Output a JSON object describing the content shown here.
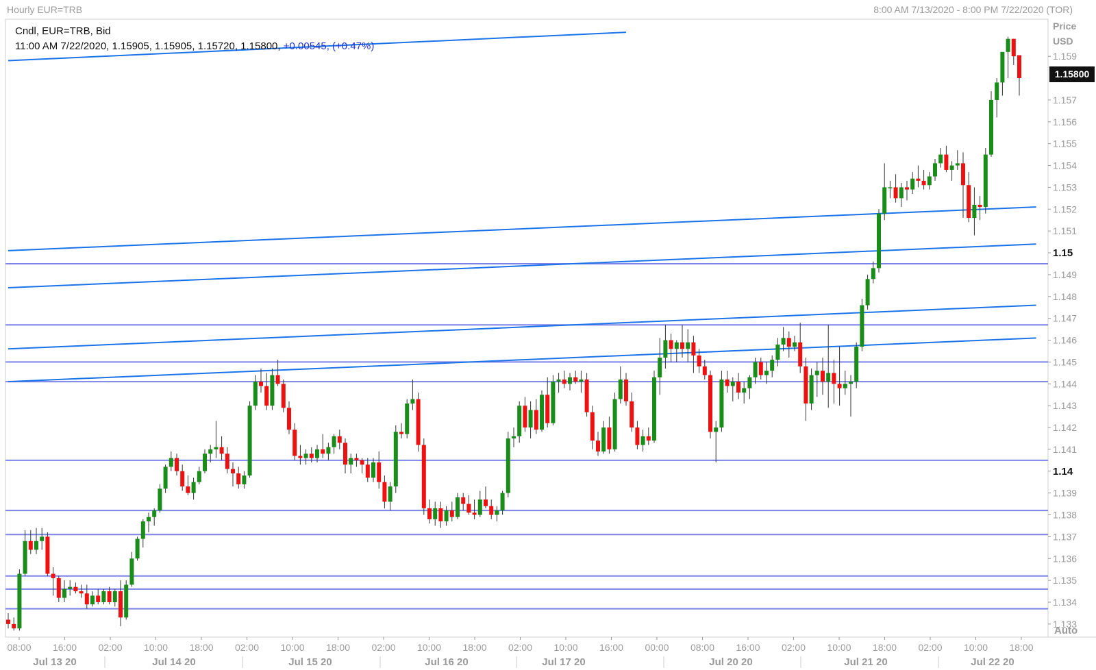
{
  "header": {
    "title": "Hourly EUR=TRB",
    "range": "8:00 AM 7/13/2020 - 8:00 PM 7/22/2020 (TOR)"
  },
  "info": {
    "line1": "Cndl, EUR=TRB, Bid",
    "line2_prefix": "11:00 AM 7/22/2020, 1.15905, 1.15905, 1.15720, 1.15800, ",
    "line2_change": "+0.00545, (+0.47%)"
  },
  "price_axis": {
    "label1": "Price",
    "label2": "USD",
    "current": "1.15800",
    "auto_label": "Auto"
  },
  "colors": {
    "up": "#1a8c1a",
    "down": "#ee1111",
    "trend": "#1a73e8",
    "level": "#7b83e8",
    "axis_text": "#9a9a9a"
  },
  "chart_data": {
    "type": "candlestick",
    "ylim": [
      1.1324,
      1.1607
    ],
    "y_ticks": [
      "1.133",
      "1.134",
      "1.135",
      "1.136",
      "1.137",
      "1.138",
      "1.139",
      "1.14",
      "1.141",
      "1.142",
      "1.143",
      "1.144",
      "1.145",
      "1.146",
      "1.147",
      "1.148",
      "1.149",
      "1.15",
      "1.151",
      "1.152",
      "1.153",
      "1.154",
      "1.155",
      "1.156",
      "1.157",
      "1.159"
    ],
    "bold_ticks": [
      "1.14",
      "1.15"
    ],
    "x_ticks": [
      "08:00",
      "16:00",
      "02:00",
      "10:00",
      "18:00",
      "02:00",
      "10:00",
      "18:00",
      "02:00",
      "10:00",
      "18:00",
      "02:00",
      "10:00",
      "16:00",
      "00:00",
      "08:00",
      "16:00",
      "02:00",
      "10:00",
      "18:00",
      "02:00",
      "10:00",
      "18:00"
    ],
    "date_labels": [
      "Jul 13 20",
      "Jul 14 20",
      "Jul 15 20",
      "Jul 16 20",
      "Jul 17 20",
      "Jul 20 20",
      "Jul 21 20",
      "Jul 22 20"
    ],
    "horizontal_levels": [
      1.1495,
      1.1467,
      1.145,
      1.1441,
      1.1405,
      1.1382,
      1.1371,
      1.1352,
      1.1346,
      1.1337
    ],
    "trend_lines": [
      {
        "from": [
          0,
          1.1501
        ],
        "to": [
          183,
          1.1521
        ]
      },
      {
        "from": [
          0,
          1.1484
        ],
        "to": [
          183,
          1.1504
        ]
      },
      {
        "from": [
          0,
          1.1456
        ],
        "to": [
          183,
          1.1476
        ]
      },
      {
        "from": [
          0,
          1.1441
        ],
        "to": [
          183,
          1.1461
        ]
      },
      {
        "from": [
          0,
          1.1588
        ],
        "to": [
          110,
          1.1601
        ]
      }
    ],
    "candles": [
      [
        1.1332,
        1.1335,
        1.1328,
        1.133
      ],
      [
        1.133,
        1.1333,
        1.1327,
        1.1328
      ],
      [
        1.1328,
        1.1355,
        1.1327,
        1.1353
      ],
      [
        1.1353,
        1.1373,
        1.1352,
        1.1368
      ],
      [
        1.1368,
        1.1373,
        1.1362,
        1.1364
      ],
      [
        1.1364,
        1.1374,
        1.1362,
        1.1368
      ],
      [
        1.1368,
        1.1374,
        1.1364,
        1.137
      ],
      [
        1.137,
        1.1372,
        1.1352,
        1.1353
      ],
      [
        1.1353,
        1.1356,
        1.1343,
        1.1351
      ],
      [
        1.1351,
        1.1352,
        1.134,
        1.1342
      ],
      [
        1.1342,
        1.135,
        1.134,
        1.1346
      ],
      [
        1.1346,
        1.135,
        1.1343,
        1.1347
      ],
      [
        1.1347,
        1.1349,
        1.1344,
        1.1345
      ],
      [
        1.1345,
        1.1348,
        1.1342,
        1.1344
      ],
      [
        1.1344,
        1.1348,
        1.1337,
        1.1339
      ],
      [
        1.1339,
        1.1345,
        1.1338,
        1.1343
      ],
      [
        1.1343,
        1.1346,
        1.1339,
        1.134
      ],
      [
        1.134,
        1.1346,
        1.1339,
        1.1345
      ],
      [
        1.1345,
        1.1347,
        1.1339,
        1.134
      ],
      [
        1.134,
        1.1346,
        1.1338,
        1.1345
      ],
      [
        1.1345,
        1.135,
        1.1329,
        1.1333
      ],
      [
        1.1333,
        1.135,
        1.1332,
        1.1348
      ],
      [
        1.1348,
        1.1363,
        1.1347,
        1.136
      ],
      [
        1.136,
        1.137,
        1.1359,
        1.1369
      ],
      [
        1.1369,
        1.1378,
        1.1365,
        1.1377
      ],
      [
        1.1377,
        1.1381,
        1.1372,
        1.1379
      ],
      [
        1.1379,
        1.1383,
        1.1375,
        1.1382
      ],
      [
        1.1382,
        1.1394,
        1.1381,
        1.1392
      ],
      [
        1.1392,
        1.1403,
        1.139,
        1.1402
      ],
      [
        1.1402,
        1.1409,
        1.14,
        1.1406
      ],
      [
        1.1406,
        1.1408,
        1.1398,
        1.14
      ],
      [
        1.14,
        1.1403,
        1.1391,
        1.1393
      ],
      [
        1.1393,
        1.1398,
        1.1389,
        1.139
      ],
      [
        1.139,
        1.1397,
        1.1387,
        1.1395
      ],
      [
        1.1395,
        1.1402,
        1.1394,
        1.14
      ],
      [
        1.14,
        1.141,
        1.1399,
        1.1408
      ],
      [
        1.1408,
        1.1412,
        1.1404,
        1.141
      ],
      [
        1.141,
        1.1423,
        1.1406,
        1.1411
      ],
      [
        1.1411,
        1.1416,
        1.1405,
        1.1408
      ],
      [
        1.1408,
        1.1411,
        1.1399,
        1.1401
      ],
      [
        1.1401,
        1.1404,
        1.1393,
        1.1399
      ],
      [
        1.1399,
        1.1402,
        1.1392,
        1.1394
      ],
      [
        1.1394,
        1.14,
        1.1392,
        1.1398
      ],
      [
        1.1398,
        1.1432,
        1.1397,
        1.143
      ],
      [
        1.143,
        1.1444,
        1.1428,
        1.1441
      ],
      [
        1.1441,
        1.1447,
        1.1436,
        1.1439
      ],
      [
        1.1439,
        1.1445,
        1.1428,
        1.143
      ],
      [
        1.143,
        1.1447,
        1.1428,
        1.1444
      ],
      [
        1.1444,
        1.1451,
        1.1439,
        1.144
      ],
      [
        1.144,
        1.1442,
        1.1427,
        1.1429
      ],
      [
        1.1429,
        1.1432,
        1.1417,
        1.1419
      ],
      [
        1.1419,
        1.1422,
        1.1405,
        1.1407
      ],
      [
        1.1407,
        1.1412,
        1.1403,
        1.1406
      ],
      [
        1.1406,
        1.141,
        1.1403,
        1.1408
      ],
      [
        1.1408,
        1.1411,
        1.1404,
        1.1406
      ],
      [
        1.1406,
        1.1412,
        1.1404,
        1.141
      ],
      [
        1.141,
        1.1417,
        1.1406,
        1.1408
      ],
      [
        1.1408,
        1.1413,
        1.1405,
        1.1411
      ],
      [
        1.1411,
        1.1417,
        1.1408,
        1.1416
      ],
      [
        1.1416,
        1.1419,
        1.141,
        1.1413
      ],
      [
        1.1413,
        1.1415,
        1.1399,
        1.1403
      ],
      [
        1.1403,
        1.1408,
        1.1399,
        1.1406
      ],
      [
        1.1406,
        1.1408,
        1.1402,
        1.1405
      ],
      [
        1.1405,
        1.1406,
        1.1399,
        1.1403
      ],
      [
        1.1403,
        1.1406,
        1.1395,
        1.1397
      ],
      [
        1.1397,
        1.1406,
        1.1395,
        1.1404
      ],
      [
        1.1404,
        1.1409,
        1.1392,
        1.1395
      ],
      [
        1.1395,
        1.1398,
        1.1383,
        1.1386
      ],
      [
        1.1386,
        1.1395,
        1.1382,
        1.1393
      ],
      [
        1.1393,
        1.1421,
        1.139,
        1.1418
      ],
      [
        1.1418,
        1.1422,
        1.1415,
        1.1417
      ],
      [
        1.1417,
        1.1433,
        1.1415,
        1.1431
      ],
      [
        1.1431,
        1.1442,
        1.1428,
        1.1433
      ],
      [
        1.1433,
        1.1436,
        1.1409,
        1.1412
      ],
      [
        1.1412,
        1.1415,
        1.138,
        1.1383
      ],
      [
        1.1383,
        1.1387,
        1.1376,
        1.1378
      ],
      [
        1.1378,
        1.1386,
        1.1375,
        1.1383
      ],
      [
        1.1383,
        1.1386,
        1.1374,
        1.1377
      ],
      [
        1.1377,
        1.1384,
        1.1375,
        1.1382
      ],
      [
        1.1382,
        1.1386,
        1.1377,
        1.1379
      ],
      [
        1.1379,
        1.139,
        1.1378,
        1.1388
      ],
      [
        1.1388,
        1.139,
        1.1382,
        1.1385
      ],
      [
        1.1385,
        1.1389,
        1.138,
        1.1381
      ],
      [
        1.1381,
        1.1387,
        1.1378,
        1.138
      ],
      [
        1.138,
        1.1391,
        1.1379,
        1.1387
      ],
      [
        1.1387,
        1.1393,
        1.1383,
        1.1384
      ],
      [
        1.1384,
        1.1387,
        1.1378,
        1.138
      ],
      [
        1.138,
        1.1384,
        1.1377,
        1.1382
      ],
      [
        1.1382,
        1.1391,
        1.138,
        1.139
      ],
      [
        1.139,
        1.1418,
        1.1388,
        1.1415
      ],
      [
        1.1415,
        1.142,
        1.1411,
        1.1416
      ],
      [
        1.1416,
        1.1432,
        1.1413,
        1.143
      ],
      [
        1.143,
        1.1434,
        1.1418,
        1.142
      ],
      [
        1.142,
        1.1432,
        1.1415,
        1.1428
      ],
      [
        1.1428,
        1.1433,
        1.1417,
        1.1419
      ],
      [
        1.1419,
        1.1437,
        1.1418,
        1.1435
      ],
      [
        1.1435,
        1.1443,
        1.142,
        1.1422
      ],
      [
        1.1422,
        1.1444,
        1.1421,
        1.1441
      ],
      [
        1.1441,
        1.1445,
        1.1436,
        1.1442
      ],
      [
        1.1442,
        1.1446,
        1.1438,
        1.144
      ],
      [
        1.144,
        1.1445,
        1.1437,
        1.1443
      ],
      [
        1.1443,
        1.1446,
        1.144,
        1.1441
      ],
      [
        1.1441,
        1.1446,
        1.1436,
        1.1442
      ],
      [
        1.1442,
        1.1445,
        1.1425,
        1.1427
      ],
      [
        1.1427,
        1.143,
        1.141,
        1.1414
      ],
      [
        1.1414,
        1.1418,
        1.1407,
        1.1409
      ],
      [
        1.1409,
        1.1423,
        1.1408,
        1.142
      ],
      [
        1.142,
        1.1425,
        1.1408,
        1.141
      ],
      [
        1.141,
        1.1436,
        1.1409,
        1.1433
      ],
      [
        1.1433,
        1.1448,
        1.1431,
        1.1442
      ],
      [
        1.1442,
        1.1445,
        1.143,
        1.1432
      ],
      [
        1.1432,
        1.1436,
        1.1418,
        1.142
      ],
      [
        1.142,
        1.1423,
        1.141,
        1.1412
      ],
      [
        1.1412,
        1.1419,
        1.1409,
        1.1416
      ],
      [
        1.1416,
        1.142,
        1.1412,
        1.1414
      ],
      [
        1.1414,
        1.1446,
        1.1413,
        1.1443
      ],
      [
        1.1443,
        1.1461,
        1.1435,
        1.1452
      ],
      [
        1.1452,
        1.1467,
        1.1447,
        1.146
      ],
      [
        1.146,
        1.1463,
        1.145,
        1.1456
      ],
      [
        1.1456,
        1.146,
        1.145,
        1.1459
      ],
      [
        1.1459,
        1.1467,
        1.1452,
        1.1456
      ],
      [
        1.1456,
        1.1465,
        1.145,
        1.1459
      ],
      [
        1.1459,
        1.1462,
        1.1445,
        1.1453
      ],
      [
        1.1453,
        1.1456,
        1.1445,
        1.1448
      ],
      [
        1.1448,
        1.1451,
        1.1442,
        1.1444
      ],
      [
        1.1444,
        1.1446,
        1.1415,
        1.1418
      ],
      [
        1.1418,
        1.1423,
        1.1404,
        1.142
      ],
      [
        1.142,
        1.1446,
        1.1418,
        1.1442
      ],
      [
        1.1442,
        1.1446,
        1.1436,
        1.1439
      ],
      [
        1.1439,
        1.1443,
        1.1432,
        1.1441
      ],
      [
        1.1441,
        1.1445,
        1.1433,
        1.1436
      ],
      [
        1.1436,
        1.1441,
        1.1431,
        1.1438
      ],
      [
        1.1438,
        1.1444,
        1.1433,
        1.1443
      ],
      [
        1.1443,
        1.1452,
        1.144,
        1.145
      ],
      [
        1.145,
        1.1452,
        1.1442,
        1.1444
      ],
      [
        1.1444,
        1.145,
        1.144,
        1.1446
      ],
      [
        1.1446,
        1.1453,
        1.1443,
        1.1451
      ],
      [
        1.1451,
        1.1461,
        1.1448,
        1.1458
      ],
      [
        1.1458,
        1.1466,
        1.1455,
        1.1461
      ],
      [
        1.1461,
        1.1464,
        1.1452,
        1.1457
      ],
      [
        1.1457,
        1.1462,
        1.1455,
        1.1459
      ],
      [
        1.1459,
        1.1468,
        1.1445,
        1.1448
      ],
      [
        1.1448,
        1.1452,
        1.1423,
        1.1431
      ],
      [
        1.1431,
        1.1447,
        1.1428,
        1.1444
      ],
      [
        1.1444,
        1.145,
        1.1434,
        1.1446
      ],
      [
        1.1446,
        1.1452,
        1.1435,
        1.1441
      ],
      [
        1.1441,
        1.1467,
        1.1429,
        1.1445
      ],
      [
        1.1445,
        1.1451,
        1.1431,
        1.144
      ],
      [
        1.144,
        1.1457,
        1.143,
        1.1438
      ],
      [
        1.1438,
        1.1446,
        1.1435,
        1.144
      ],
      [
        1.144,
        1.1444,
        1.1425,
        1.1441
      ],
      [
        1.1441,
        1.1459,
        1.1438,
        1.1457
      ],
      [
        1.1457,
        1.1479,
        1.1455,
        1.1476
      ],
      [
        1.1476,
        1.149,
        1.1474,
        1.1488
      ],
      [
        1.1488,
        1.1496,
        1.1486,
        1.1493
      ],
      [
        1.1493,
        1.152,
        1.1491,
        1.1518
      ],
      [
        1.1518,
        1.1541,
        1.1515,
        1.153
      ],
      [
        1.153,
        1.1533,
        1.1525,
        1.153
      ],
      [
        1.153,
        1.1536,
        1.1523,
        1.1525
      ],
      [
        1.1525,
        1.1532,
        1.1521,
        1.153
      ],
      [
        1.153,
        1.1533,
        1.1524,
        1.1529
      ],
      [
        1.1529,
        1.1537,
        1.1527,
        1.1534
      ],
      [
        1.1534,
        1.154,
        1.153,
        1.1533
      ],
      [
        1.1533,
        1.1538,
        1.1529,
        1.1531
      ],
      [
        1.1531,
        1.1537,
        1.1529,
        1.1535
      ],
      [
        1.1535,
        1.1543,
        1.1533,
        1.1541
      ],
      [
        1.1541,
        1.1548,
        1.1539,
        1.1545
      ],
      [
        1.1545,
        1.1549,
        1.1537,
        1.1538
      ],
      [
        1.1538,
        1.1542,
        1.1533,
        1.154
      ],
      [
        1.154,
        1.1547,
        1.1538,
        1.1541
      ],
      [
        1.1541,
        1.1546,
        1.1516,
        1.1531
      ],
      [
        1.1531,
        1.1537,
        1.1514,
        1.1516
      ],
      [
        1.1516,
        1.153,
        1.1508,
        1.1522
      ],
      [
        1.1522,
        1.1526,
        1.1515,
        1.1521
      ],
      [
        1.1521,
        1.1548,
        1.1518,
        1.1545
      ],
      [
        1.1545,
        1.1574,
        1.1544,
        1.157
      ],
      [
        1.157,
        1.158,
        1.1562,
        1.1578
      ],
      [
        1.1578,
        1.1587,
        1.1572,
        1.1592
      ],
      [
        1.1592,
        1.1599,
        1.158,
        1.1598
      ],
      [
        1.1598,
        1.1598,
        1.1586,
        1.159
      ],
      [
        1.15905,
        1.15905,
        1.1572,
        1.158
      ]
    ]
  }
}
